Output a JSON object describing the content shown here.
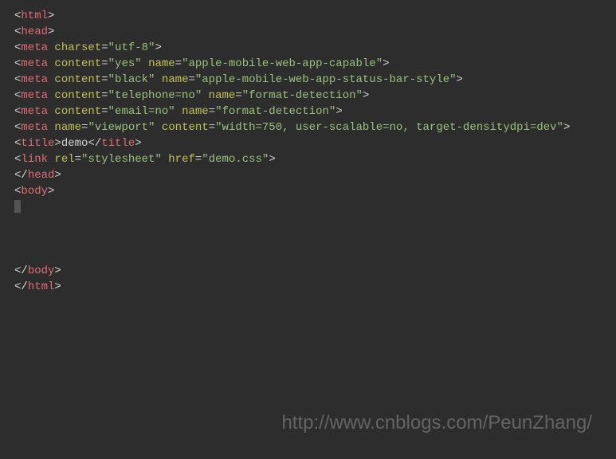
{
  "code": {
    "lines": [
      {
        "type": "open",
        "tag": "html",
        "attrs": []
      },
      {
        "type": "open",
        "tag": "head",
        "attrs": []
      },
      {
        "type": "self",
        "tag": "meta",
        "attrs": [
          {
            "name": "charset",
            "value": "utf-8"
          }
        ]
      },
      {
        "type": "self",
        "tag": "meta",
        "attrs": [
          {
            "name": "content",
            "value": "yes"
          },
          {
            "name": "name",
            "value": "apple-mobile-web-app-capable"
          }
        ]
      },
      {
        "type": "self",
        "tag": "meta",
        "attrs": [
          {
            "name": "content",
            "value": "black"
          },
          {
            "name": "name",
            "value": "apple-mobile-web-app-status-bar-style"
          }
        ]
      },
      {
        "type": "self",
        "tag": "meta",
        "attrs": [
          {
            "name": "content",
            "value": "telephone=no"
          },
          {
            "name": "name",
            "value": "format-detection"
          }
        ]
      },
      {
        "type": "self",
        "tag": "meta",
        "attrs": [
          {
            "name": "content",
            "value": "email=no"
          },
          {
            "name": "name",
            "value": "format-detection"
          }
        ]
      },
      {
        "type": "self",
        "tag": "meta",
        "attrs": [
          {
            "name": "name",
            "value": "viewport"
          },
          {
            "name": "content",
            "value": "width=750, user-scalable=no, target-densitydpi=dev"
          }
        ]
      },
      {
        "type": "pair",
        "tag": "title",
        "text": "demo",
        "attrs": []
      },
      {
        "type": "self",
        "tag": "link",
        "attrs": [
          {
            "name": "rel",
            "value": "stylesheet"
          },
          {
            "name": "href",
            "value": "demo.css"
          }
        ]
      },
      {
        "type": "close",
        "tag": "head"
      },
      {
        "type": "open",
        "tag": "body",
        "attrs": []
      },
      {
        "type": "blank-cursor"
      },
      {
        "type": "blank"
      },
      {
        "type": "blank"
      },
      {
        "type": "blank"
      },
      {
        "type": "close",
        "tag": "body"
      },
      {
        "type": "close",
        "tag": "html"
      }
    ]
  },
  "watermark": "http://www.cnblogs.com/PeunZhang/"
}
